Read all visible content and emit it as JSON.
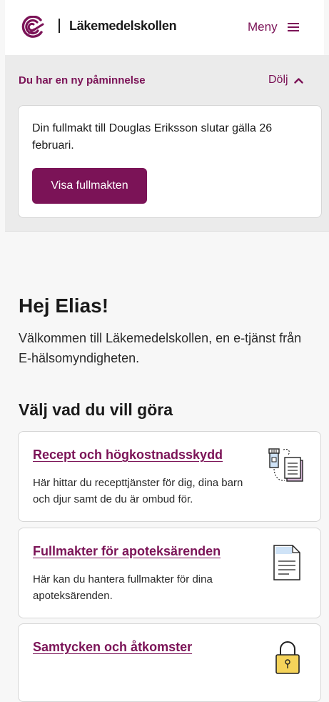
{
  "header": {
    "brand": "Läkemedelskollen",
    "menu_label": "Meny"
  },
  "reminder": {
    "title": "Du har en ny påminnelse",
    "hide_label": "Dölj",
    "message": "Din fullmakt till Douglas Eriksson slutar gälla 26 februari.",
    "button_label": "Visa fullmakten"
  },
  "main": {
    "greeting": "Hej Elias!",
    "welcome": "Välkommen till Läkemedelskollen, en e-tjänst från E-hälsomyndigheten.",
    "choose_heading": "Välj vad du vill göra"
  },
  "cards": [
    {
      "title": "Recept och högkostnadsskydd",
      "description": "Här hittar du recepttjänster för dig, dina barn och djur samt de du är ombud för.",
      "icon": "prescription-icon"
    },
    {
      "title": "Fullmakter för apoteksärenden",
      "description": "Här kan du hantera fullmakter för dina apoteksärenden.",
      "icon": "document-icon"
    },
    {
      "title": "Samtycken och åtkomster",
      "description": "",
      "icon": "padlock-icon"
    }
  ],
  "colors": {
    "brand": "#7b1357",
    "background": "#f7f7f7",
    "reminder_background": "#ebebeb"
  }
}
